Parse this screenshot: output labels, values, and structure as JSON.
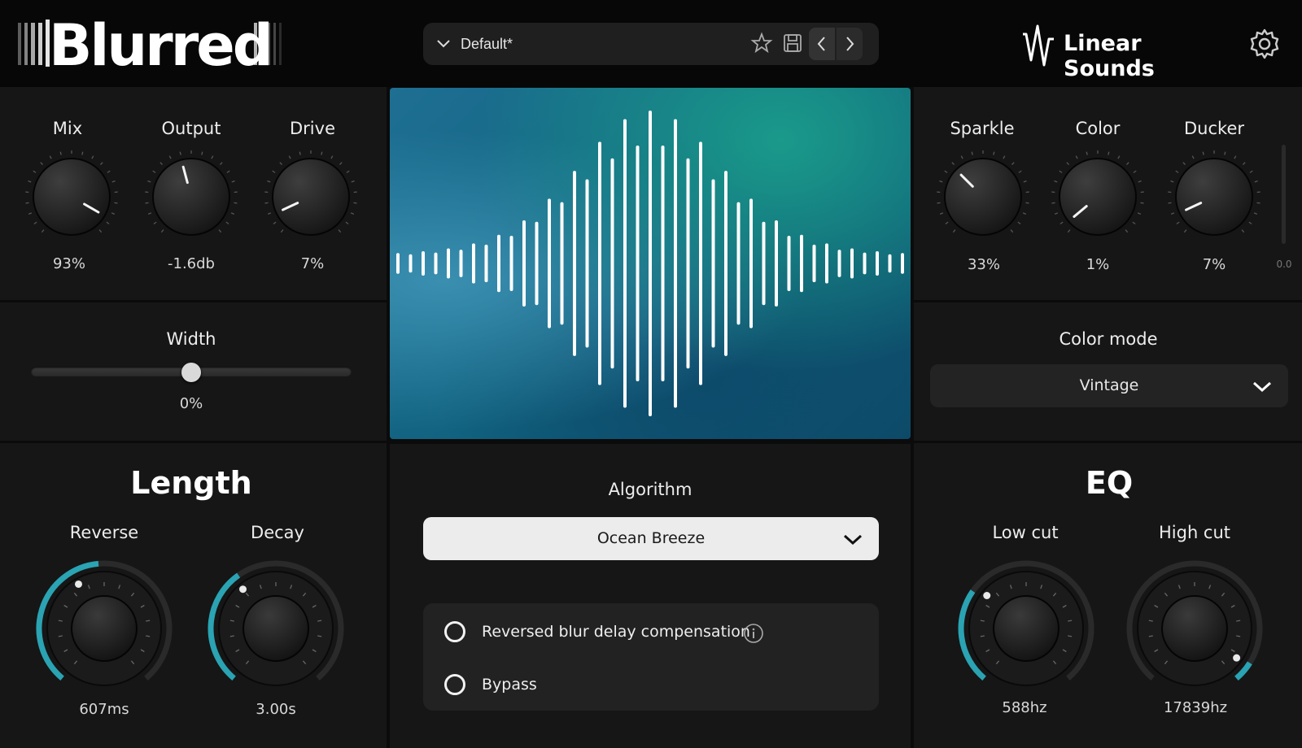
{
  "header": {
    "logo_text": "Blurred",
    "preset_name": "Default*",
    "brand_name": "Linear Sounds"
  },
  "left_top": {
    "knobs": [
      {
        "label": "Mix",
        "value": "93%"
      },
      {
        "label": "Output",
        "value": "-1.6db"
      },
      {
        "label": "Drive",
        "value": "7%"
      }
    ]
  },
  "width": {
    "label": "Width",
    "value": "0%"
  },
  "length": {
    "title": "Length",
    "knobs": [
      {
        "label": "Reverse",
        "value": "607ms"
      },
      {
        "label": "Decay",
        "value": "3.00s"
      }
    ]
  },
  "center": {
    "algorithm_label": "Algorithm",
    "algorithm_value": "Ocean Breeze",
    "options": [
      {
        "label": "Reversed blur delay compensation",
        "checked": false
      },
      {
        "label": "Bypass",
        "checked": false
      }
    ]
  },
  "right_top": {
    "knobs": [
      {
        "label": "Sparkle",
        "value": "33%"
      },
      {
        "label": "Color",
        "value": "1%"
      },
      {
        "label": "Ducker",
        "value": "7%"
      }
    ],
    "meter_value": "0.0"
  },
  "color_mode": {
    "label": "Color mode",
    "value": "Vintage"
  },
  "eq": {
    "title": "EQ",
    "knobs": [
      {
        "label": "Low cut",
        "value": "588hz"
      },
      {
        "label": "High cut",
        "value": "17839hz"
      }
    ]
  },
  "colors": {
    "accent": "#2aa3b3",
    "panel": "#161616",
    "header": "#070707"
  }
}
